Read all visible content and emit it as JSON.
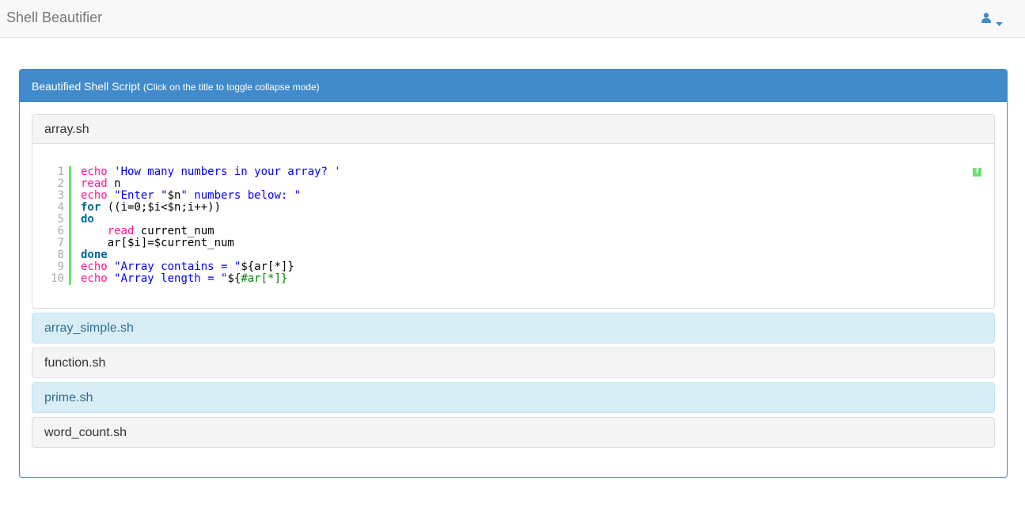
{
  "app": {
    "title": "Shell Beautifier"
  },
  "user_menu": {
    "icon": "user-icon",
    "dropdown_icon": "caret-down-icon"
  },
  "panel": {
    "title": "Beautified Shell Script",
    "hint": "(Click on the title to toggle collapse mode)"
  },
  "files": [
    {
      "name": "array.sh",
      "style": "default",
      "expanded": true
    },
    {
      "name": "array_simple.sh",
      "style": "info",
      "expanded": false
    },
    {
      "name": "function.sh",
      "style": "default",
      "expanded": false
    },
    {
      "name": "prime.sh",
      "style": "info",
      "expanded": false
    },
    {
      "name": "word_count.sh",
      "style": "default",
      "expanded": false
    }
  ],
  "code": {
    "help_label": "?",
    "lines": [
      {
        "num": "1",
        "parts": [
          [
            "cmd",
            "echo"
          ],
          [
            "plain",
            " "
          ],
          [
            "str",
            "'How many numbers in your array? '"
          ]
        ]
      },
      {
        "num": "2",
        "parts": [
          [
            "cmd",
            "read"
          ],
          [
            "plain",
            " n"
          ]
        ]
      },
      {
        "num": "3",
        "parts": [
          [
            "cmd",
            "echo"
          ],
          [
            "plain",
            " "
          ],
          [
            "str",
            "\"Enter \""
          ],
          [
            "plain",
            "$n"
          ],
          [
            "str",
            "\" numbers below: \""
          ]
        ]
      },
      {
        "num": "4",
        "parts": [
          [
            "bold",
            "for"
          ],
          [
            "plain",
            " ((i=0;$i<$n;i++))"
          ]
        ]
      },
      {
        "num": "5",
        "parts": [
          [
            "bold",
            "do"
          ]
        ]
      },
      {
        "num": "6",
        "parts": [
          [
            "plain",
            "    "
          ],
          [
            "cmd",
            "read"
          ],
          [
            "plain",
            " current_num"
          ]
        ]
      },
      {
        "num": "7",
        "parts": [
          [
            "plain",
            "    ar[$i]=$current_num"
          ]
        ]
      },
      {
        "num": "8",
        "parts": [
          [
            "bold",
            "done"
          ]
        ]
      },
      {
        "num": "9",
        "parts": [
          [
            "cmd",
            "echo"
          ],
          [
            "plain",
            " "
          ],
          [
            "str",
            "\"Array contains = \""
          ],
          [
            "plain",
            "${ar[*]}"
          ]
        ]
      },
      {
        "num": "10",
        "parts": [
          [
            "cmd",
            "echo"
          ],
          [
            "plain",
            " "
          ],
          [
            "str",
            "\"Array length = \""
          ],
          [
            "plain",
            "${"
          ],
          [
            "green",
            "#ar[*]}"
          ]
        ]
      }
    ]
  },
  "colors": {
    "primary": "#428bca",
    "info_bg": "#d9edf7",
    "gutter": "#6ce26c"
  }
}
